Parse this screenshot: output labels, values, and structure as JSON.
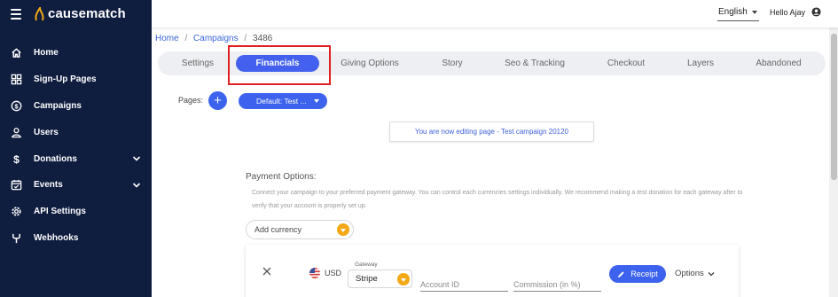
{
  "app": {
    "logo_text": "causematch",
    "colors": {
      "sidebar": "#0f1d3f",
      "accent": "#4361ee",
      "orange": "#f3a814",
      "highlight": "#e02020"
    }
  },
  "sidebar": {
    "items": [
      {
        "label": "Home",
        "icon": "home-icon"
      },
      {
        "label": "Sign-Up Pages",
        "icon": "pages-grid-icon"
      },
      {
        "label": "Campaigns",
        "icon": "dollar-circle-icon"
      },
      {
        "label": "Users",
        "icon": "user-icon"
      },
      {
        "label": "Donations",
        "icon": "dollar-icon",
        "expandable": true
      },
      {
        "label": "Events",
        "icon": "calendar-icon",
        "expandable": true
      },
      {
        "label": "API Settings",
        "icon": "gear-icon"
      },
      {
        "label": "Webhooks",
        "icon": "webhook-icon"
      }
    ]
  },
  "topbar": {
    "language": "English",
    "greeting": "Hello Ajay"
  },
  "breadcrumb": {
    "home": "Home",
    "sep1": "/",
    "campaigns": "Campaigns",
    "sep2": "/",
    "current": "3486"
  },
  "tabs": [
    {
      "label": "Settings"
    },
    {
      "label": "Financials",
      "active": true
    },
    {
      "label": "Giving Options"
    },
    {
      "label": "Story"
    },
    {
      "label": "Seo & Tracking"
    },
    {
      "label": "Checkout"
    },
    {
      "label": "Layers"
    },
    {
      "label": "Abandoned"
    }
  ],
  "pages": {
    "label": "Pages:",
    "add_symbol": "+",
    "selected": "Default: Test ..."
  },
  "notice": "You are now editing page - Test campaign 20120",
  "payment": {
    "title": "Payment Options:",
    "description": "Connect your campaign to your preferred payment gateway. You can control each currencies settings individually. We recommend making a test donation for each gateway after to verify that your account is properly set up.",
    "add_currency": "Add currency"
  },
  "currency_card": {
    "currency": "USD",
    "gateway_label": "Gateway",
    "gateway_value": "Stripe",
    "account_id_placeholder": "Account ID",
    "commission_placeholder": "Commission (in %)",
    "receipt_label": "Receipt",
    "options_label": "Options"
  }
}
